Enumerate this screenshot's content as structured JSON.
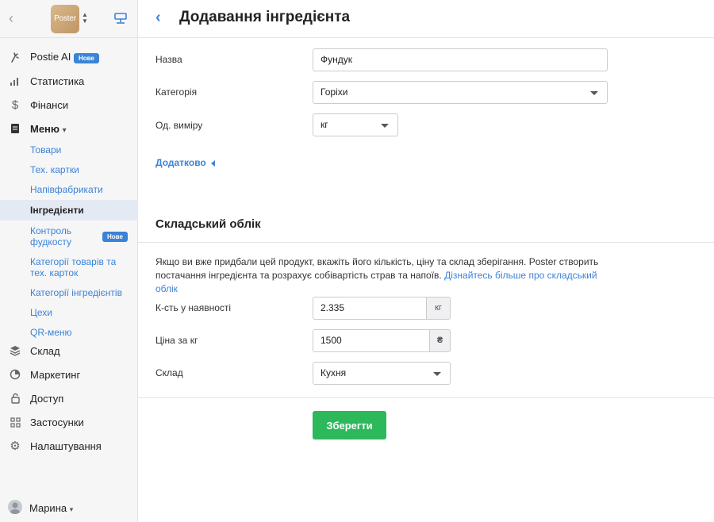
{
  "sidebar": {
    "logo_text": "Poster",
    "items": [
      {
        "label": "Postie AI",
        "badge": "Нове",
        "icon": "postie-ai-icon"
      },
      {
        "label": "Статистика",
        "icon": "stats-icon"
      },
      {
        "label": "Фінанси",
        "icon": "dollar-icon"
      },
      {
        "label": "Меню",
        "icon": "document-icon"
      },
      {
        "label": "Склад",
        "icon": "layers-icon"
      },
      {
        "label": "Маркетинг",
        "icon": "marketing-icon"
      },
      {
        "label": "Доступ",
        "icon": "lock-icon"
      },
      {
        "label": "Застосунки",
        "icon": "apps-icon"
      },
      {
        "label": "Налаштування",
        "icon": "gear-icon"
      }
    ],
    "menu_subitems": [
      {
        "label": "Товари"
      },
      {
        "label": "Тех. картки"
      },
      {
        "label": "Напівфабрикати"
      },
      {
        "label": "Інгредієнти"
      },
      {
        "label": "Контроль фудкосту",
        "badge": "Нове"
      },
      {
        "label": "Категорії товарів та тех. карток"
      },
      {
        "label": "Категорії інгредієнтів"
      },
      {
        "label": "Цехи"
      },
      {
        "label": "QR-меню"
      }
    ],
    "user": {
      "name": "Марина"
    }
  },
  "header": {
    "title": "Додавання інгредієнта"
  },
  "form": {
    "name": {
      "label": "Назва",
      "value": "Фундук"
    },
    "category": {
      "label": "Категорія",
      "value": "Горіхи"
    },
    "unit": {
      "label": "Од. виміру",
      "value": "кг"
    },
    "more_label": "Додатково"
  },
  "stock": {
    "title": "Складський облік",
    "description": "Якщо ви вже придбали цей продукт, вкажіть його кількість, ціну та склад зберігання. Poster створить постачання інгредієнта та розрахує собівартість страв та напоїв.",
    "learn_more": "Дізнайтесь більше про складський облік",
    "quantity": {
      "label": "К-сть у наявності",
      "value": "2.335",
      "unit": "кг"
    },
    "price": {
      "label": "Ціна за кг",
      "value": "1500",
      "currency": "₴"
    },
    "warehouse": {
      "label": "Склад",
      "value": "Кухня"
    }
  },
  "save_label": "Зберегти",
  "colors": {
    "accent": "#3b83d7",
    "success": "#2eb85c",
    "active_bg": "#e4eaf3"
  }
}
